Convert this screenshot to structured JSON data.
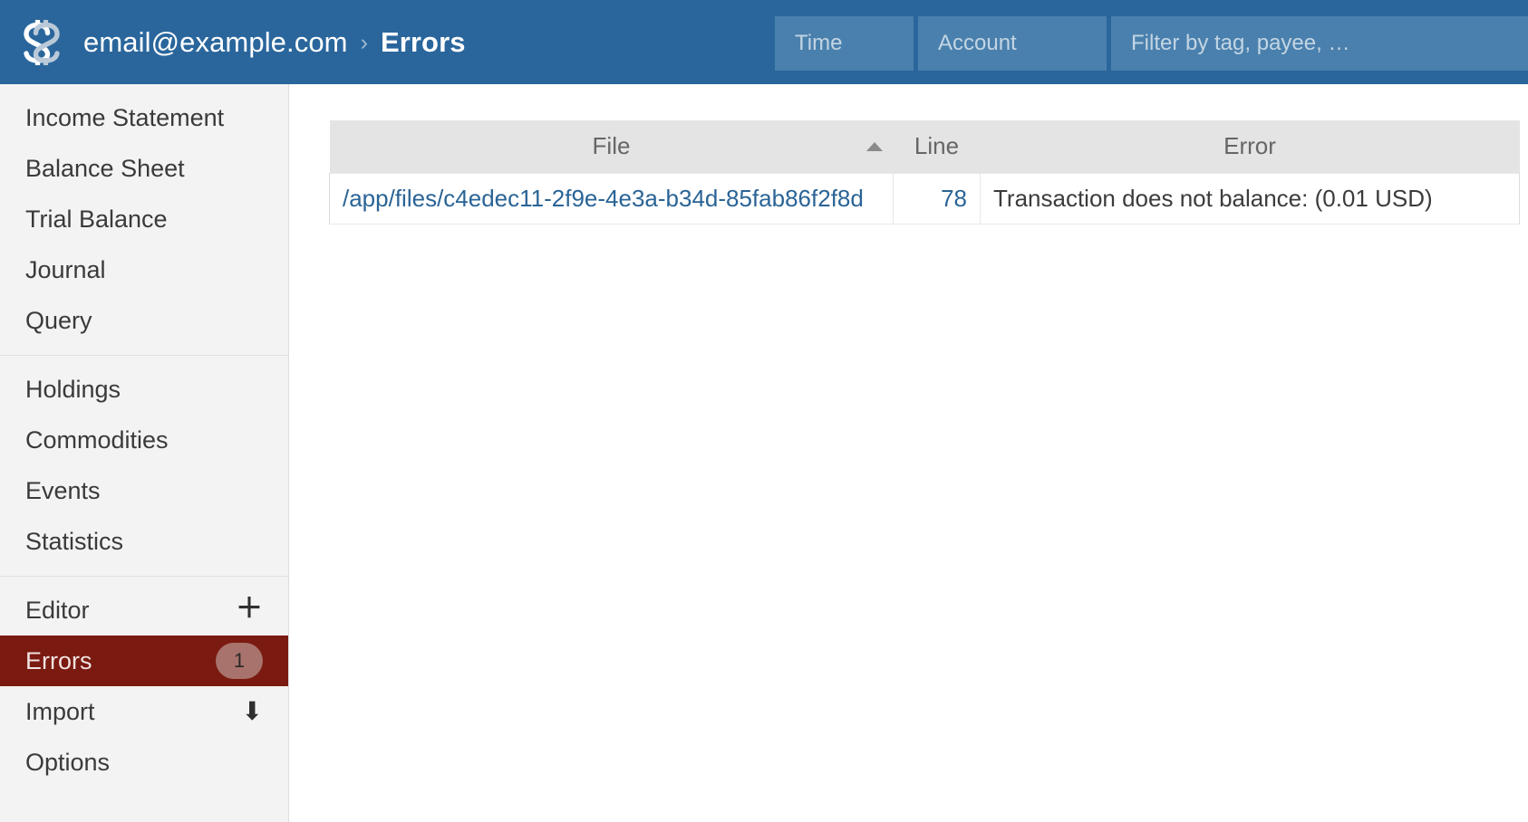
{
  "header": {
    "logo_name": "fava-logo",
    "breadcrumb": {
      "ledger": "email@example.com",
      "separator": "›",
      "current": "Errors"
    },
    "filters": {
      "time": {
        "value": "",
        "placeholder": "Time"
      },
      "account": {
        "value": "",
        "placeholder": "Account"
      },
      "tag_payee": {
        "value": "",
        "placeholder": "Filter by tag, payee, …"
      },
      "contact_icon": "contact-card-icon"
    },
    "colors": {
      "header_background": "#2a669c",
      "filter_background": "#4a80ad",
      "placeholder": "#c3d5e4"
    }
  },
  "sidebar": {
    "groups": [
      {
        "items": [
          {
            "label": "Income Statement",
            "selected": false
          },
          {
            "label": "Balance Sheet",
            "selected": false
          },
          {
            "label": "Trial Balance",
            "selected": false
          },
          {
            "label": "Journal",
            "selected": false
          },
          {
            "label": "Query",
            "selected": false
          }
        ]
      },
      {
        "items": [
          {
            "label": "Holdings",
            "selected": false
          },
          {
            "label": "Commodities",
            "selected": false
          },
          {
            "label": "Events",
            "selected": false
          },
          {
            "label": "Statistics",
            "selected": false
          }
        ]
      },
      {
        "items": [
          {
            "label": "Editor",
            "selected": false,
            "aux_icon": "plus-icon",
            "aux_glyph": "＋"
          },
          {
            "label": "Errors",
            "selected": true,
            "badge": "1"
          },
          {
            "label": "Import",
            "selected": false,
            "aux_icon": "download-arrow-icon",
            "aux_glyph": "⬇"
          },
          {
            "label": "Options",
            "selected": false
          }
        ]
      }
    ],
    "colors": {
      "background": "#f3f3f3",
      "selected_background": "#7a1a10",
      "badge_background": "#a8736c"
    }
  },
  "main": {
    "table": {
      "columns": [
        {
          "label": "File",
          "sorted": true,
          "sort_direction": "ascending"
        },
        {
          "label": "Line",
          "sorted": false
        },
        {
          "label": "Error",
          "sorted": false
        }
      ],
      "rows": [
        {
          "file": "/app/files/c4edec11-2f9e-4e3a-b34d-85fab86f2f8d",
          "line": "78",
          "error": "Transaction does not balance: (0.01 USD)"
        }
      ]
    }
  }
}
